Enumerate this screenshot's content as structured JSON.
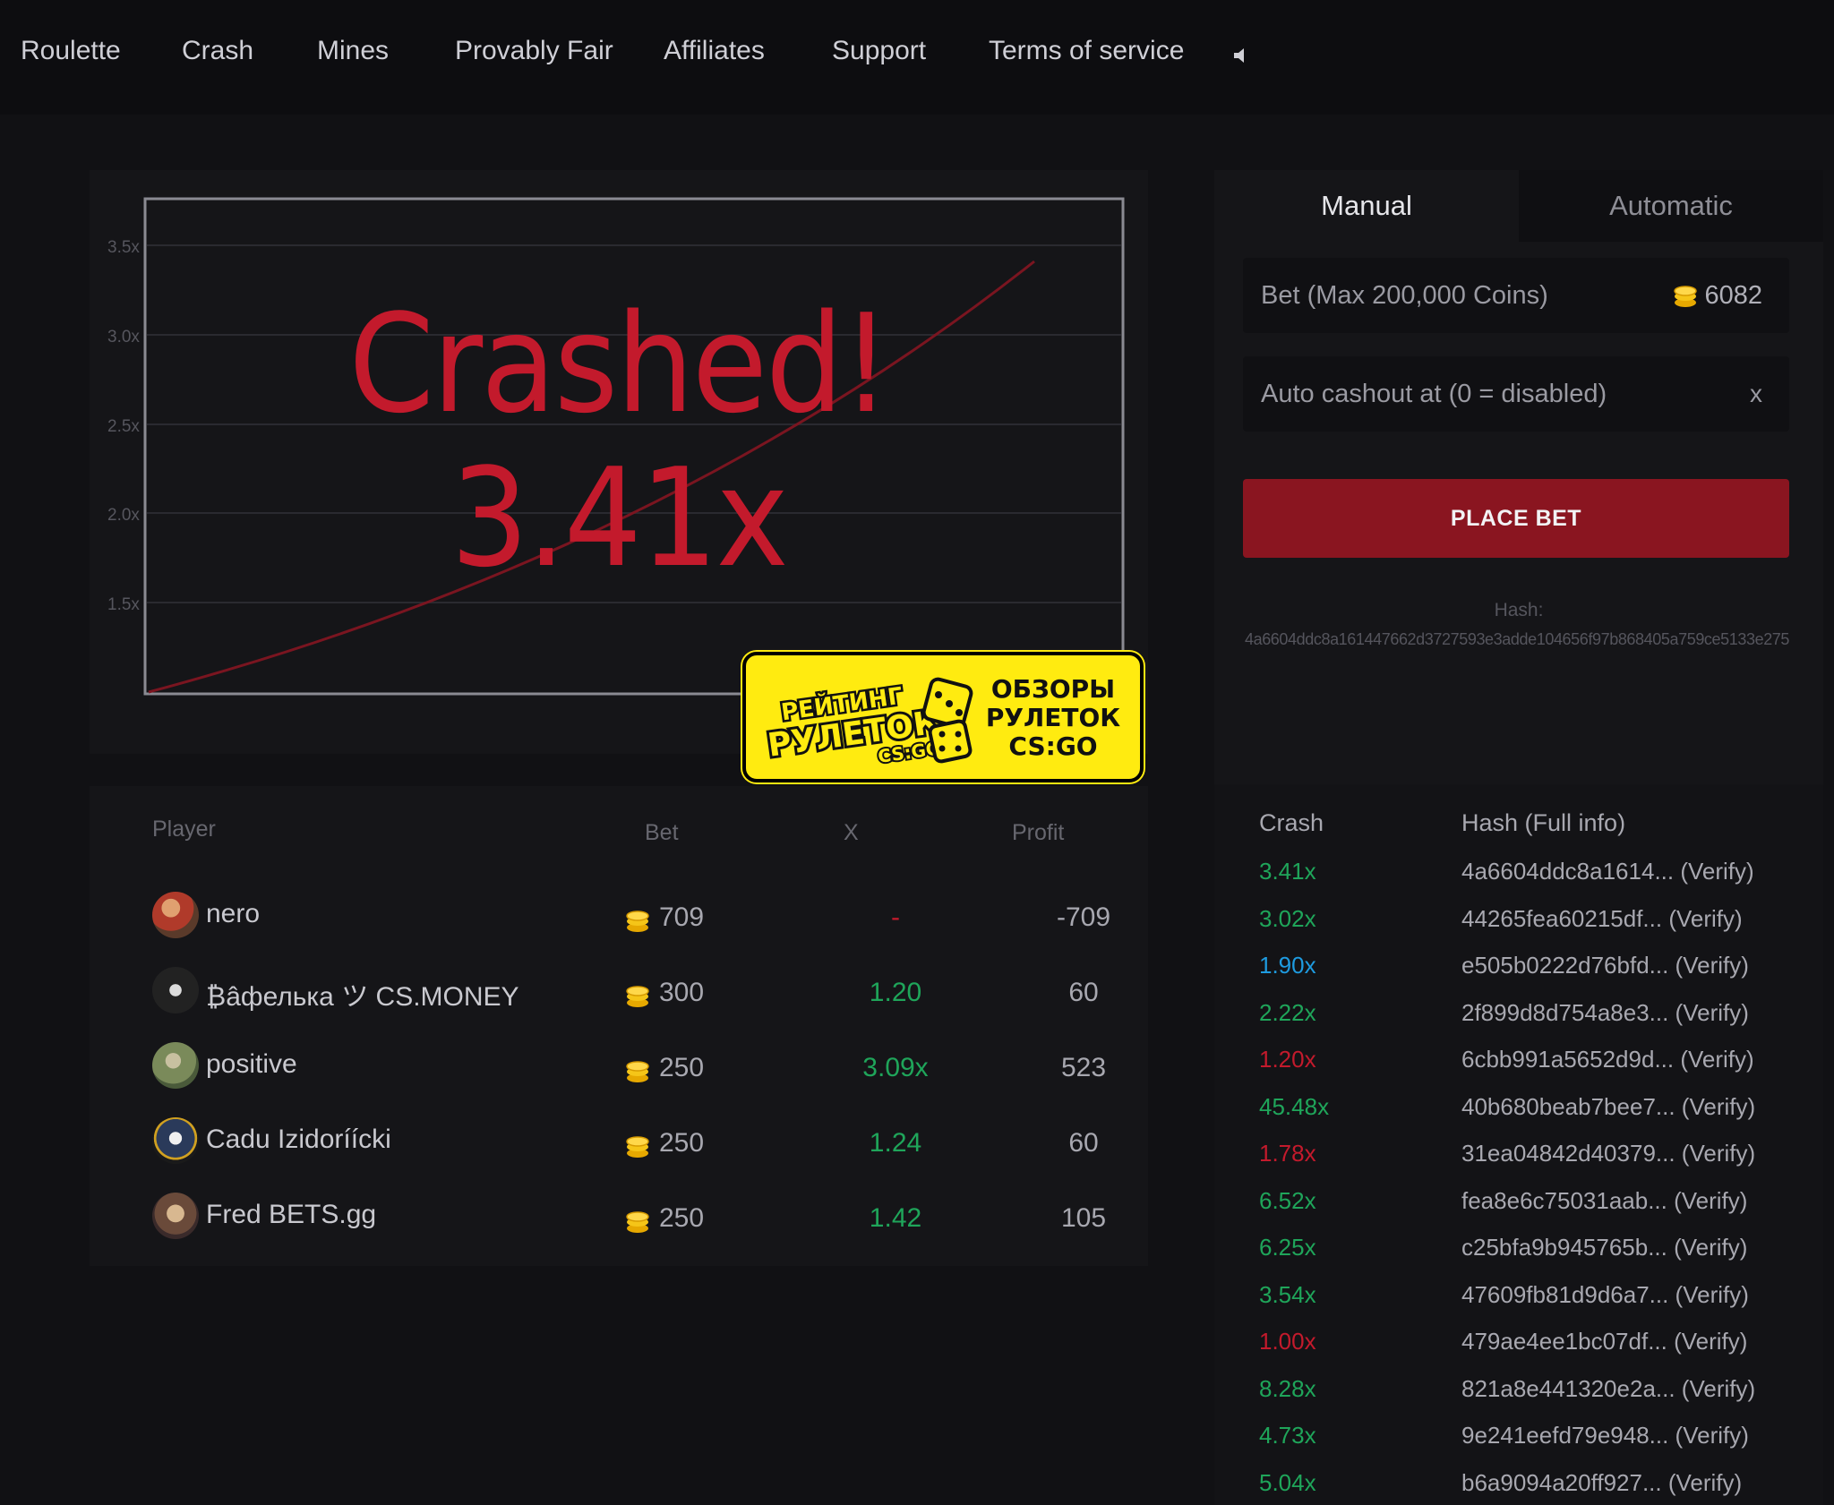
{
  "nav": {
    "items": [
      "Roulette",
      "Crash",
      "Mines",
      "Provably Fair",
      "Affiliates",
      "Support",
      "Terms of service"
    ]
  },
  "graph": {
    "y_ticks": [
      "3.5x",
      "3.0x",
      "2.5x",
      "2.0x",
      "1.5x"
    ],
    "crashed_label": "Crashed!",
    "multiplier": "3.41x"
  },
  "logo": {
    "left_line1": "РЕЙТИНГ",
    "left_line2": "РУЛЕТОК",
    "left_line3": "CS:GO",
    "right_line1": "ОБЗОРЫ",
    "right_line2": "РУЛЕТОК",
    "right_line3": "CS:GO"
  },
  "players": {
    "headers": {
      "player": "Player",
      "bet": "Bet",
      "x": "X",
      "profit": "Profit"
    },
    "rows": [
      {
        "name": "nero",
        "bet": "709",
        "x": "-",
        "profit": "-709",
        "x_color": "#c31a2c"
      },
      {
        "name": "₿âфелька ツ CS.MONEY",
        "bet": "300",
        "x": "1.20",
        "profit": "60",
        "x_color": "#1fa55a"
      },
      {
        "name": "positive",
        "bet": "250",
        "x": "3.09x",
        "profit": "523",
        "x_color": "#1fa55a"
      },
      {
        "name": "Cadu Izidoríícki",
        "bet": "250",
        "x": "1.24",
        "profit": "60",
        "x_color": "#1fa55a"
      },
      {
        "name": "Fred BETS.gg",
        "bet": "250",
        "x": "1.42",
        "profit": "105",
        "x_color": "#1fa55a"
      }
    ]
  },
  "bet": {
    "tabs": {
      "manual": "Manual",
      "automatic": "Automatic"
    },
    "bet_label": "Bet (Max 200,000 Coins)",
    "bet_value": "6082",
    "autocashout_label": "Auto cashout at (0 = disabled)",
    "autocashout_suffix": "x",
    "place_bet": "PLACE BET",
    "hash_label": "Hash:",
    "hash_value": "4a6604ddc8a161447662d3727593e3adde104656f97b868405a759ce5133e275"
  },
  "history": {
    "headers": {
      "crash": "Crash",
      "hash": "Hash (Full info)"
    },
    "rows": [
      {
        "crash": "3.41x",
        "hash": "4a6604ddc8a1614... (Verify)",
        "color": "#1fa55a"
      },
      {
        "crash": "3.02x",
        "hash": "44265fea60215df... (Verify)",
        "color": "#1fa55a"
      },
      {
        "crash": "1.90x",
        "hash": "e505b0222d76bfd... (Verify)",
        "color": "#1e9be0"
      },
      {
        "crash": "2.22x",
        "hash": "2f899d8d754a8e3... (Verify)",
        "color": "#1fa55a"
      },
      {
        "crash": "1.20x",
        "hash": "6cbb991a5652d9d... (Verify)",
        "color": "#c31a2c"
      },
      {
        "crash": "45.48x",
        "hash": "40b680beab7bee7... (Verify)",
        "color": "#1fa55a"
      },
      {
        "crash": "1.78x",
        "hash": "31ea04842d40379... (Verify)",
        "color": "#c31a2c"
      },
      {
        "crash": "6.52x",
        "hash": "fea8e6c75031aab... (Verify)",
        "color": "#1fa55a"
      },
      {
        "crash": "6.25x",
        "hash": "c25bfa9b945765b... (Verify)",
        "color": "#1fa55a"
      },
      {
        "crash": "3.54x",
        "hash": "47609fb81d9d6a7... (Verify)",
        "color": "#1fa55a"
      },
      {
        "crash": "1.00x",
        "hash": "479ae4ee1bc07df... (Verify)",
        "color": "#c31a2c"
      },
      {
        "crash": "8.28x",
        "hash": "821a8e441320e2a... (Verify)",
        "color": "#1fa55a"
      },
      {
        "crash": "4.73x",
        "hash": "9e241eefd79e948... (Verify)",
        "color": "#1fa55a"
      },
      {
        "crash": "5.04x",
        "hash": "b6a9094a20ff927... (Verify)",
        "color": "#1fa55a"
      }
    ]
  }
}
